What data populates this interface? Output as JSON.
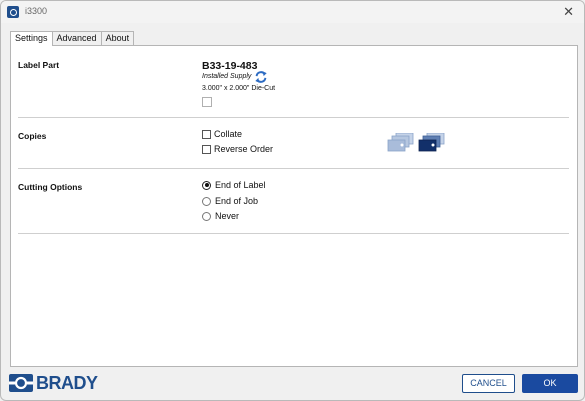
{
  "window": {
    "title": "i3300"
  },
  "tabs": [
    {
      "label": "Settings",
      "active": true
    },
    {
      "label": "Advanced",
      "active": false
    },
    {
      "label": "About",
      "active": false
    }
  ],
  "label_part": {
    "section_title": "Label Part",
    "part_number": "B33-19-483",
    "installed_text": "Installed Supply",
    "dimensions": "3.000\" x 2.000\" Die-Cut"
  },
  "copies": {
    "section_title": "Copies",
    "options": [
      {
        "label": "Collate",
        "checked": false
      },
      {
        "label": "Reverse Order",
        "checked": false
      }
    ]
  },
  "cutting": {
    "section_title": "Cutting Options",
    "options": [
      {
        "label": "End of Label",
        "selected": true
      },
      {
        "label": "End of Job",
        "selected": false
      },
      {
        "label": "Never",
        "selected": false
      }
    ]
  },
  "footer": {
    "brand": "BRADY",
    "cancel_label": "CANCEL",
    "ok_label": "OK"
  },
  "colors": {
    "brand_blue": "#1f4e8c",
    "ok_blue": "#1a4aa0",
    "refresh_blue": "#2d6bc2"
  }
}
